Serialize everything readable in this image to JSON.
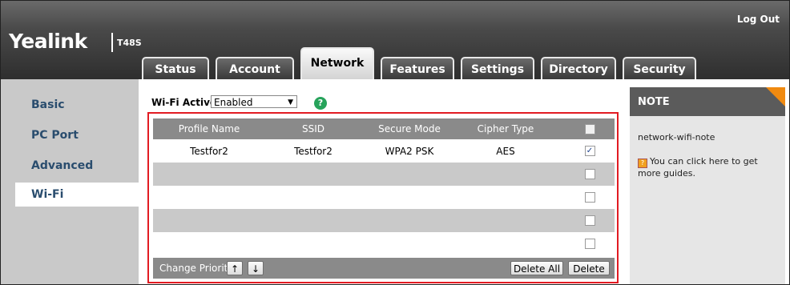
{
  "header": {
    "logo": "Yealink",
    "model": "T48S",
    "logout": "Log Out"
  },
  "tabs": [
    {
      "label": "Status"
    },
    {
      "label": "Account"
    },
    {
      "label": "Network"
    },
    {
      "label": "Features"
    },
    {
      "label": "Settings"
    },
    {
      "label": "Directory"
    },
    {
      "label": "Security"
    }
  ],
  "active_tab": "Network",
  "sidebar": {
    "items": [
      {
        "label": "Basic"
      },
      {
        "label": "PC Port"
      },
      {
        "label": "Advanced"
      },
      {
        "label": "Wi-Fi"
      }
    ],
    "selected": "Wi-Fi"
  },
  "wifi_active": {
    "label": "Wi-Fi Active",
    "value": "Enabled"
  },
  "table": {
    "headers": [
      "Profile Name",
      "SSID",
      "Secure Mode",
      "Cipher Type"
    ],
    "rows": [
      {
        "profile": "Testfor2",
        "ssid": "Testfor2",
        "mode": "WPA2 PSK",
        "cipher": "AES",
        "checked": true
      },
      {
        "profile": "",
        "ssid": "",
        "mode": "",
        "cipher": "",
        "checked": false
      },
      {
        "profile": "",
        "ssid": "",
        "mode": "",
        "cipher": "",
        "checked": false
      },
      {
        "profile": "",
        "ssid": "",
        "mode": "",
        "cipher": "",
        "checked": false
      },
      {
        "profile": "",
        "ssid": "",
        "mode": "",
        "cipher": "",
        "checked": false
      }
    ]
  },
  "footer": {
    "change_priority": "Change Priority",
    "up": "↑",
    "down": "↓",
    "delete_all": "Delete All",
    "delete": "Delete"
  },
  "note": {
    "title": "NOTE",
    "text": "network-wifi-note",
    "guide": "You can click here to get more guides."
  },
  "colors": {
    "highlight_frame": "#e21b22",
    "note_corner": "#f08a10",
    "sidebar_link": "#2a4d6e"
  }
}
